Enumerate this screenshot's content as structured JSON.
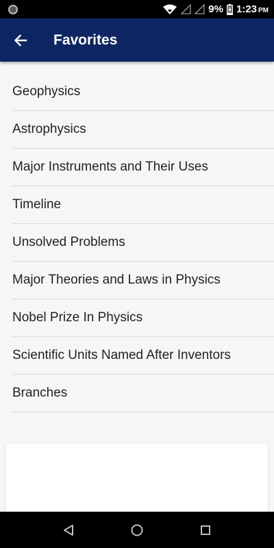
{
  "status_bar": {
    "battery_percent": "9%",
    "time": "1:23",
    "ampm": "PM",
    "icons": [
      "notification-dot-icon",
      "wifi-icon",
      "signal-icon",
      "signal-icon",
      "battery-charging-icon"
    ]
  },
  "app_bar": {
    "title": "Favorites",
    "back_icon": "arrow-left-icon",
    "background_color": "#0d2663"
  },
  "favorites": {
    "items": [
      {
        "label": "Geophysics"
      },
      {
        "label": "Astrophysics"
      },
      {
        "label": "Major Instruments and Their Uses"
      },
      {
        "label": "Timeline"
      },
      {
        "label": "Unsolved Problems"
      },
      {
        "label": "Major Theories and Laws in Physics"
      },
      {
        "label": "Nobel Prize In Physics"
      },
      {
        "label": "Scientific Units Named After Inventors"
      },
      {
        "label": "Branches"
      }
    ]
  },
  "nav_bar": {
    "icons": [
      "back-triangle-icon",
      "home-circle-icon",
      "recents-square-icon"
    ]
  }
}
